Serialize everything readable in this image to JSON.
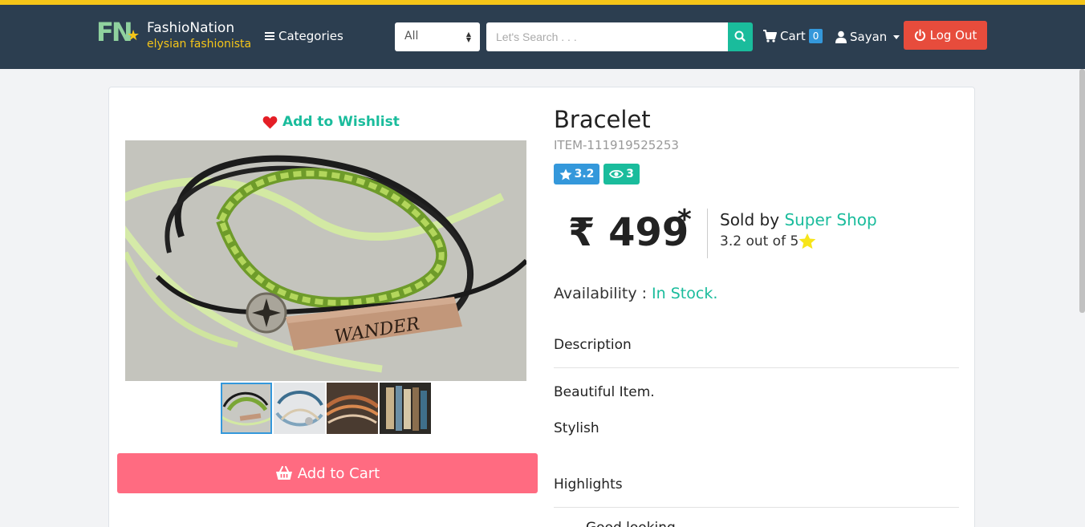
{
  "header": {
    "brand_name": "FashioNation",
    "brand_tagline": "elysian fashionista",
    "logo_text": "FN",
    "categories_label": "Categories",
    "filter_selected": "All",
    "search_placeholder": "Let's Search . . .",
    "cart_label": "Cart",
    "cart_count": "0",
    "user_name": "Sayan",
    "logout_label": "Log Out"
  },
  "product": {
    "wishlist_label": "Add to Wishlist",
    "title": "Bracelet",
    "item_code": "ITEM-111919525253",
    "rating_badge": "3.2",
    "views_badge": "3",
    "price": "₹ 499",
    "price_sup": "*",
    "sold_by_prefix": "Sold by ",
    "seller": "Super Shop",
    "rating_text": "3.2 out of 5",
    "availability_label": "Availability : ",
    "availability_value": "In Stock.",
    "add_to_cart_label": "Add to Cart",
    "description_heading": "Description",
    "description_lines": [
      "Beautiful Item.",
      "Stylish"
    ],
    "highlights_heading": "Highlights",
    "highlight_first": "Good looking",
    "main_image_text": "WANDER"
  },
  "colors": {
    "navbar": "#2c3e50",
    "accent_teal": "#1abc9c",
    "accent_yellow": "#f5c518",
    "logout_red": "#e74c3c",
    "cart_pink": "#ff6b81",
    "badge_blue": "#3498db"
  },
  "icons": {
    "categories": "hamburger-icon",
    "search": "search-icon",
    "cart": "shopping-cart-icon",
    "user": "user-icon",
    "logout": "power-icon",
    "wishlist": "heart-icon",
    "rating": "star-icon",
    "views": "eye-icon",
    "add_to_cart": "basket-icon"
  }
}
